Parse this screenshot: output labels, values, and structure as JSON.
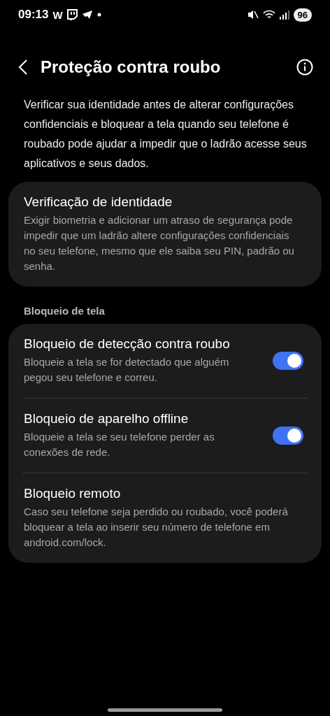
{
  "status_bar": {
    "time": "09:13",
    "app_letter": "W",
    "battery": "96"
  },
  "header": {
    "title": "Proteção contra roubo"
  },
  "intro": "Verificar sua identidade antes de alterar configurações confidenciais e bloquear a tela quando seu telefone é roubado pode ajudar a impedir que o ladrão acesse seus aplicativos e seus dados.",
  "identity_card": {
    "title": "Verificação de identidade",
    "description": "Exigir biometria e adicionar um atraso de segurança pode impedir que um ladrão altere configurações confidenciais no seu telefone, mesmo que ele saiba seu PIN, padrão ou senha."
  },
  "section_label": "Bloqueio de tela",
  "lock_items": [
    {
      "kind": "toggle",
      "title": "Bloqueio de detecção contra roubo",
      "description": "Bloqueie a tela se for detectado que alguém pegou seu telefone e correu.",
      "on": true
    },
    {
      "kind": "toggle",
      "title": "Bloqueio de aparelho offline",
      "description": "Bloqueie a tela se seu telefone perder as conexões de rede.",
      "on": true
    },
    {
      "kind": "plain",
      "title": "Bloqueio remoto",
      "description": "Caso seu telefone seja perdido ou roubado, você poderá bloquear a tela ao inserir seu número de telefone em android.com/lock."
    }
  ]
}
